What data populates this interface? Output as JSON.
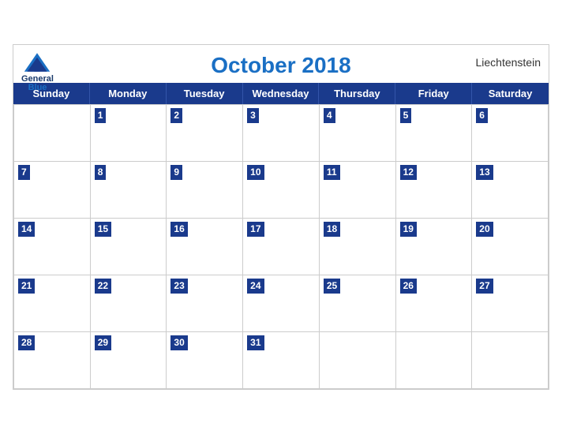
{
  "calendar": {
    "title": "October 2018",
    "country": "Liechtenstein",
    "logo": {
      "line1": "General",
      "line2": "Blue"
    },
    "days_of_week": [
      "Sunday",
      "Monday",
      "Tuesday",
      "Wednesday",
      "Thursday",
      "Friday",
      "Saturday"
    ],
    "weeks": [
      [
        null,
        1,
        2,
        3,
        4,
        5,
        6
      ],
      [
        7,
        8,
        9,
        10,
        11,
        12,
        13
      ],
      [
        14,
        15,
        16,
        17,
        18,
        19,
        20
      ],
      [
        21,
        22,
        23,
        24,
        25,
        26,
        27
      ],
      [
        28,
        29,
        30,
        31,
        null,
        null,
        null
      ]
    ]
  }
}
